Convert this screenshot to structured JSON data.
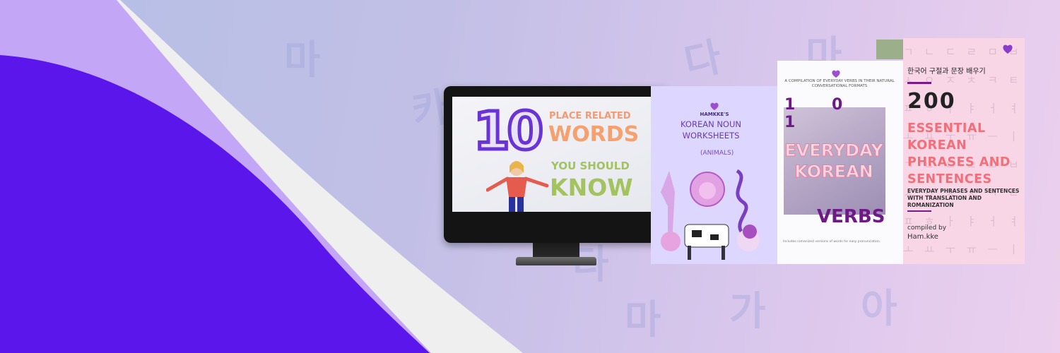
{
  "background": {
    "colors": {
      "deep_purple": "#5b16ec",
      "lilac": "#c4a6f6",
      "cream": "#efefef"
    },
    "watermark_glyphs": [
      "마",
      "다",
      "마",
      "카",
      "마",
      "가",
      "아",
      "다"
    ]
  },
  "monitor_slide": {
    "number": "10",
    "line1": "PLACE RELATED",
    "line2": "WORDS",
    "line3": "YOU SHOULD",
    "line4": "KNOW"
  },
  "book_noun": {
    "brand": "HAMKKE'S",
    "title": "KOREAN NOUN WORKSHEETS",
    "subtitle": "(ANIMALS)"
  },
  "book_verbs": {
    "top_text": "A COMPILATION OF EVERYDAY VERBS IN THEIR NATURAL CONVERSATIONAL FORMATS",
    "number": "1 0 1",
    "title_line1": "EVERYDAY",
    "title_line2": "KOREAN",
    "title_line3": "VERBS",
    "footer": "Includes romanized versions of words for easy pronunciation."
  },
  "book_phrases": {
    "korean_heading": "한국어 구절과 문장 배우기",
    "number": "200",
    "title_lines": [
      "ESSENTIAL",
      "KOREAN",
      "PHRASES AND",
      "SENTENCES"
    ],
    "description": "EVERYDAY PHRASES AND SENTENCES WITH TRANSLATION AND ROMANIZATION",
    "compiled_by": "compiled by",
    "author": "Ham.kke"
  }
}
